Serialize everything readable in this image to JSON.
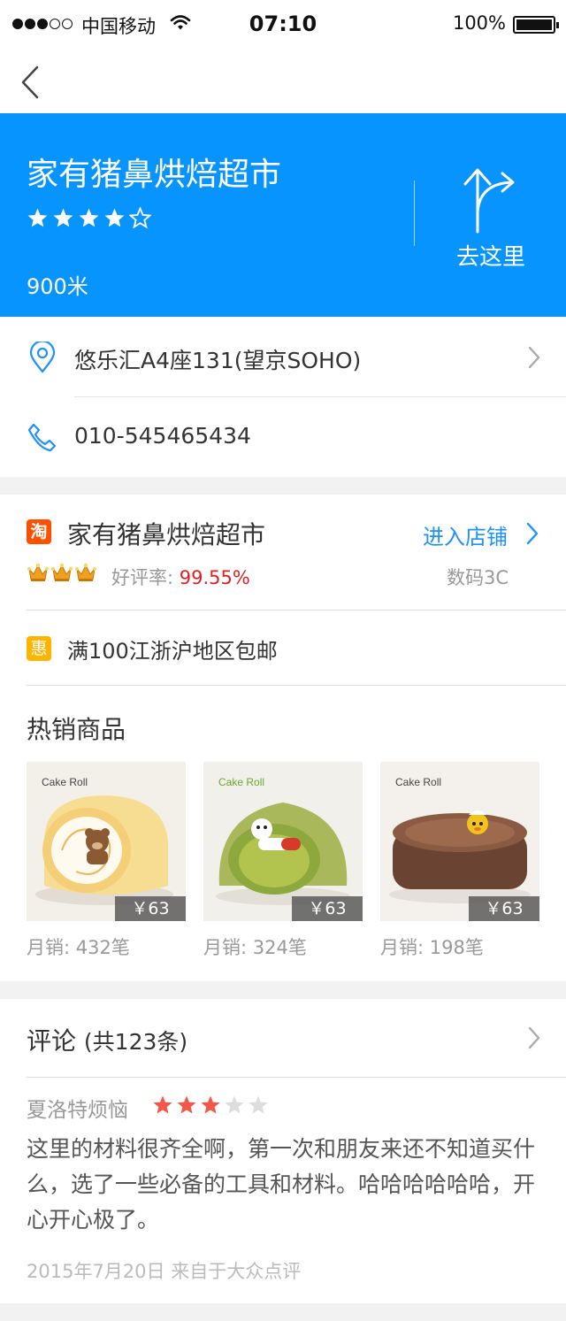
{
  "status_bar": {
    "carrier": "中国移动",
    "time": "07:10",
    "battery": "100%"
  },
  "nav": {
    "back_icon": "chevron-left-icon"
  },
  "shop": {
    "name": "家有猪鼻烘焙超市",
    "rating": 4,
    "rating_max": 5,
    "distance": "900米",
    "navigate_label": "去这里",
    "address": "悠乐汇A4座131(望京SOHO)",
    "phone": "010-545465434"
  },
  "store": {
    "badge": "淘",
    "name": "家有猪鼻烘焙超市",
    "enter_label": "进入店铺",
    "crown_count": 3,
    "rate_label": "好评率: ",
    "rate_value": "99.55%",
    "category": "数码3C",
    "promo_badge": "惠",
    "promo_text": "满100江浙沪地区包邮",
    "hot_title": "热销商品",
    "products": [
      {
        "brand": "Cake Roll",
        "price": "￥63",
        "sales": "月销: 432笔"
      },
      {
        "brand": "Cake Roll",
        "price": "￥63",
        "sales": "月销: 324笔"
      },
      {
        "brand": "Cake Roll",
        "price": "￥63",
        "sales": "月销: 198笔"
      }
    ]
  },
  "reviews": {
    "title": "评论",
    "count_label": "(共123条)",
    "items": [
      {
        "author": "夏洛特烦恼",
        "rating": 3,
        "rating_max": 5,
        "text": "这里的材料很齐全啊，第一次和朋友来还不知道买什么，选了一些必备的工具和材料。哈哈哈哈哈哈，开心开心极了。",
        "meta": "2015年7月20日 来自于大众点评"
      }
    ]
  },
  "colors": {
    "primary": "#0894ff",
    "link": "#1e90ff",
    "taobao": "#ff5000",
    "promo": "#ffb400",
    "rate": "#e02020",
    "star_active": "#f2574a",
    "star_inactive": "#dddddd",
    "crown": "#f0a020"
  }
}
